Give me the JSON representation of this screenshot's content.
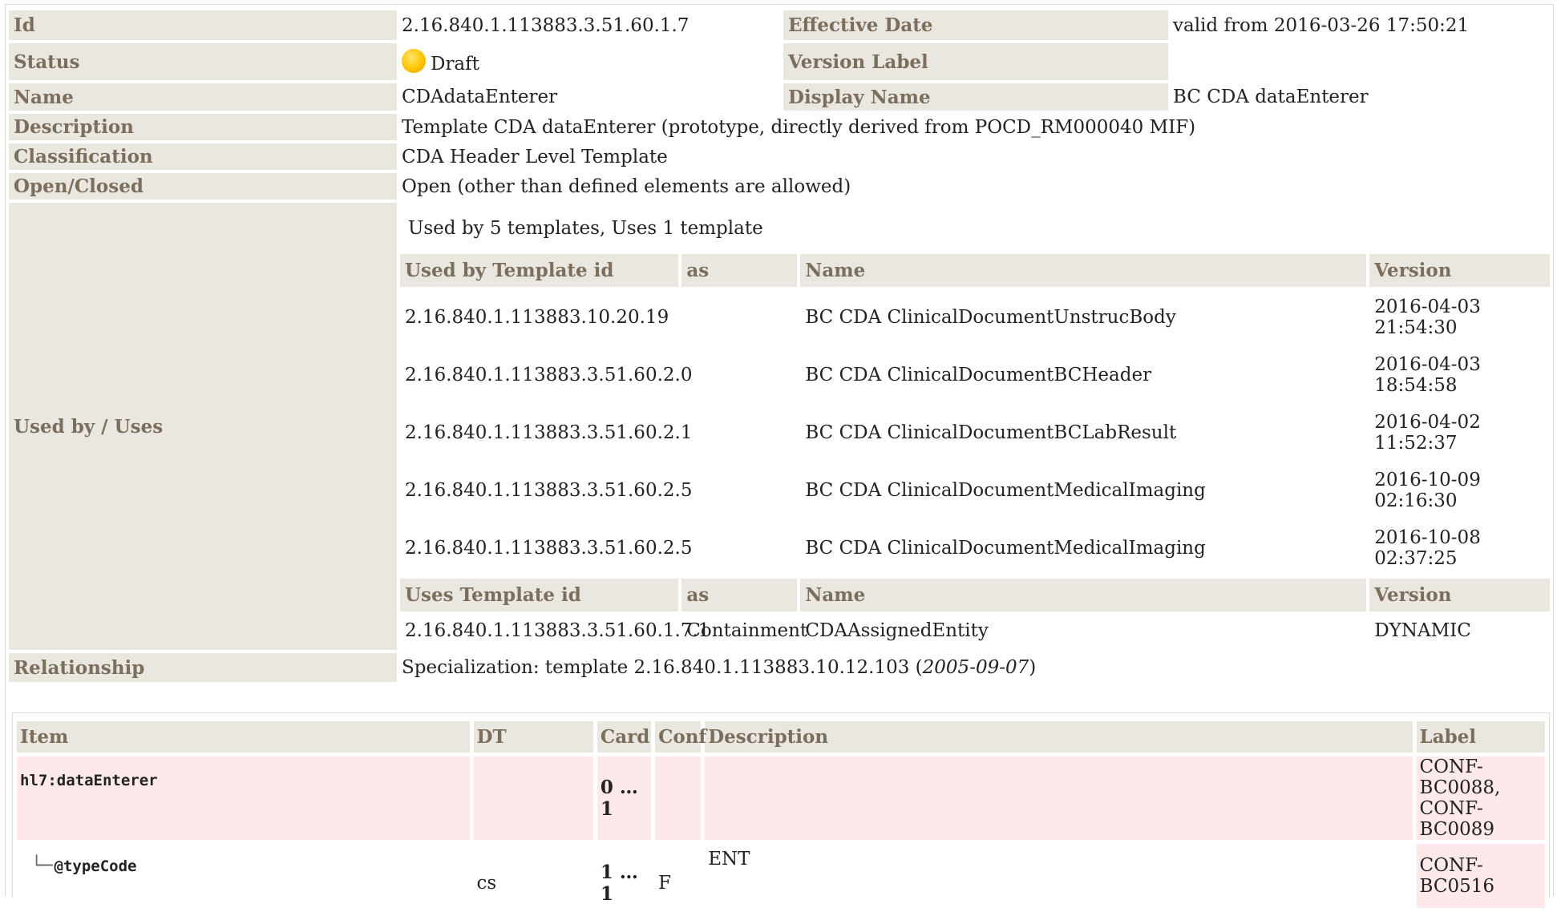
{
  "meta": {
    "id_label": "Id",
    "id_value": "2.16.840.1.113883.3.51.60.1.7",
    "effective_date_label": "Effective Date",
    "effective_date_value": "valid from 2016-03-26 17:50:21",
    "status_label": "Status",
    "status_value": "Draft",
    "version_label_label": "Version Label",
    "version_label_value": "",
    "name_label": "Name",
    "name_value": "CDAdataEnterer",
    "display_name_label": "Display Name",
    "display_name_value": "BC CDA dataEnterer",
    "description_label": "Description",
    "description_value": "Template CDA dataEnterer (prototype, directly derived from POCD_RM000040 MIF)",
    "classification_label": "Classification",
    "classification_value": "CDA Header Level Template",
    "open_closed_label": "Open/Closed",
    "open_closed_value": "Open (other than defined elements are allowed)",
    "used_by_uses_label": "Used by / Uses",
    "relationship_label": "Relationship",
    "relationship_prefix": "Specialization: template 2.16.840.1.113883.10.12.103 (",
    "relationship_date": "2005-09-07",
    "relationship_suffix": ")"
  },
  "usage": {
    "summary": "Used by 5 templates, Uses 1 template",
    "used_by_headers": [
      "Used by Template id",
      "as",
      "Name",
      "Version"
    ],
    "used_by_rows": [
      {
        "id": "2.16.840.1.113883.10.20.19",
        "as": "",
        "name": "BC CDA ClinicalDocumentUnstrucBody",
        "version_date": "2016-04-03",
        "version_time": "21:54:30"
      },
      {
        "id": "2.16.840.1.113883.3.51.60.2.0",
        "as": "",
        "name": "BC CDA ClinicalDocumentBCHeader",
        "version_date": "2016-04-03",
        "version_time": "18:54:58"
      },
      {
        "id": "2.16.840.1.113883.3.51.60.2.1",
        "as": "",
        "name": "BC CDA ClinicalDocumentBCLabResult",
        "version_date": "2016-04-02",
        "version_time": "11:52:37"
      },
      {
        "id": "2.16.840.1.113883.3.51.60.2.5",
        "as": "",
        "name": "BC CDA ClinicalDocumentMedicalImaging",
        "version_date": "2016-10-09",
        "version_time": "02:16:30"
      },
      {
        "id": "2.16.840.1.113883.3.51.60.2.5",
        "as": "",
        "name": "BC CDA ClinicalDocumentMedicalImaging",
        "version_date": "2016-10-08",
        "version_time": "02:37:25"
      }
    ],
    "uses_headers": [
      "Uses Template id",
      "as",
      "Name",
      "Version"
    ],
    "uses_rows": [
      {
        "id": "2.16.840.1.113883.3.51.60.1.7.1",
        "as": "Containment",
        "name": "CDAAssignedEntity",
        "version": "DYNAMIC"
      }
    ]
  },
  "items": {
    "headers": [
      "Item",
      "DT",
      "Card",
      "Conf",
      "Description",
      "Label"
    ],
    "rows": [
      {
        "item": "hl7:dataEnterer",
        "dt": "",
        "card": "0 … 1",
        "conf": "",
        "description": "",
        "label_line1": "CONF-BC0088,",
        "label_line2": "CONF-BC0089"
      },
      {
        "item": "@typeCode",
        "dt": "cs",
        "card": "1 … 1",
        "conf": "F",
        "description": "ENT",
        "label_line1": "CONF-BC0516",
        "label_line2": ""
      }
    ]
  }
}
